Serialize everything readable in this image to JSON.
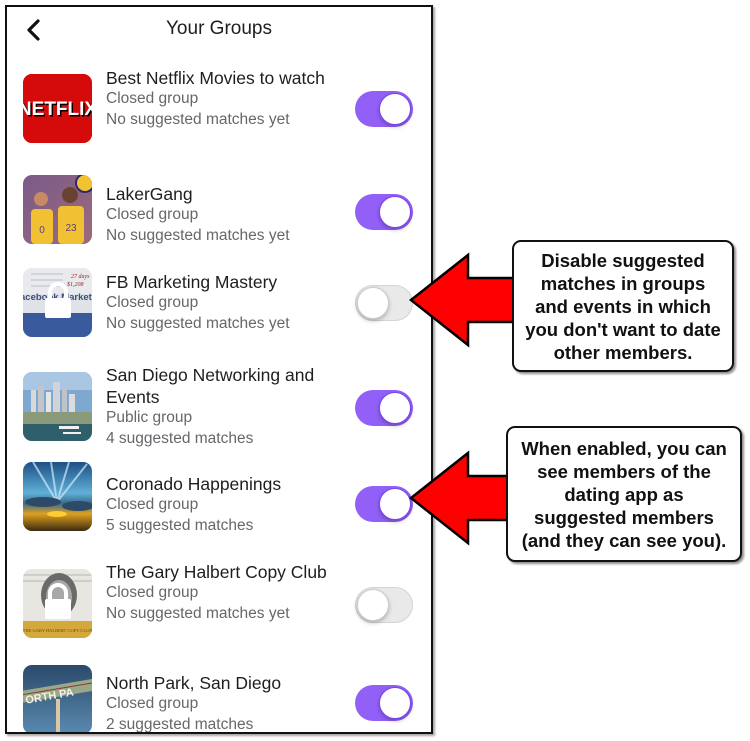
{
  "header": {
    "title": "Your Groups",
    "back_icon": "chevron-left-icon"
  },
  "groups": [
    {
      "name": "Best Netflix Movies to watch",
      "privacy": "Closed group",
      "matches": "No suggested matches yet",
      "enabled": true,
      "thumb": "netflix-logo",
      "thumb_text": "NETFLIX"
    },
    {
      "name": "LakerGang",
      "privacy": "Closed group",
      "matches": "No suggested matches yet",
      "enabled": true,
      "thumb": "lakers-players-photo"
    },
    {
      "name": "FB Marketing Mastery",
      "privacy": "Closed group",
      "matches": "No suggested matches yet",
      "enabled": false,
      "thumb": "facebook-marketing-photo-locked",
      "thumb_text": "acebook Marketing M"
    },
    {
      "name": "San Diego Networking and Events",
      "privacy": "Public group",
      "matches": "4 suggested matches",
      "enabled": true,
      "thumb": "san-diego-skyline-photo"
    },
    {
      "name": "Coronado Happenings",
      "privacy": "Closed group",
      "matches": "5 suggested matches",
      "enabled": true,
      "thumb": "sunset-sky-photo"
    },
    {
      "name": "The Gary Halbert Copy Club",
      "privacy": "Closed group",
      "matches": "No suggested matches yet",
      "enabled": false,
      "thumb": "gary-halbert-photo-locked",
      "thumb_text": "THE GARY HALBERT COPY CLUB"
    },
    {
      "name": "North Park, San Diego",
      "privacy": "Closed group",
      "matches": "2 suggested matches",
      "enabled": true,
      "thumb": "north-park-sign-photo",
      "thumb_text": "ORTH PA"
    }
  ],
  "annotations": [
    {
      "text": "Disable suggested matches in groups and events in which you don't want to date other members.",
      "points_to": "FB Marketing Mastery toggle"
    },
    {
      "text": "When enabled, you can see members of the dating app as suggested members (and they can see you).",
      "points_to": "Coronado Happenings toggle"
    }
  ],
  "colors": {
    "toggle_on": "#9360f7",
    "toggle_off": "#e9e9ea",
    "arrow": "#ff0000",
    "primary_text": "#1c1e21",
    "secondary_text": "#65676b"
  }
}
